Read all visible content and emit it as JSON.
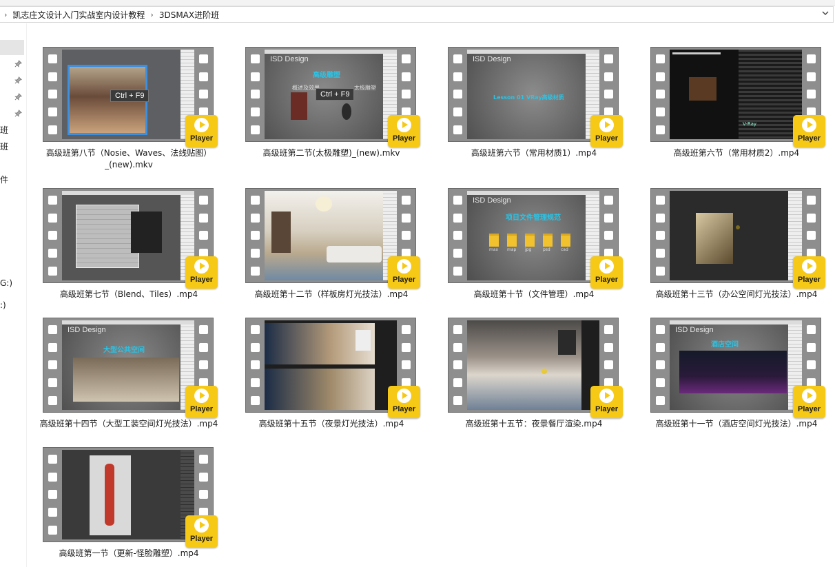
{
  "breadcrumb": {
    "items": [
      "凯志庄文设计入门实战室内设计教程",
      "3DSMAX进阶班"
    ]
  },
  "nav": {
    "fragments": [
      "班",
      "班",
      "件",
      "G:)",
      ":)"
    ]
  },
  "badge_label": "Player",
  "files": [
    {
      "name": "高级班第八节（Nosie、Waves、法线贴图）_(new).mkv",
      "style": "room-ctrl"
    },
    {
      "name": "高级班第二节(太极雕塑)_(new).mkv",
      "style": "slide-ctrl"
    },
    {
      "name": "高级班第六节（常用材质1）.mp4",
      "style": "slide-gray"
    },
    {
      "name": "高级班第六节（常用材质2）.mp4",
      "style": "material"
    },
    {
      "name": "高级班第七节（Blend、Tiles）.mp4",
      "style": "dialog"
    },
    {
      "name": "高级班第十二节（样板房灯光技法）.mp4",
      "style": "living"
    },
    {
      "name": "高级班第十节（文件管理）.mp4",
      "style": "folders"
    },
    {
      "name": "高级班第十三节（办公空间灯光技法）.mp4",
      "style": "dark-photo"
    },
    {
      "name": "高级班第十四节（大型工装空间灯光技法）.mp4",
      "style": "slide-hall"
    },
    {
      "name": "高级班第十五节（夜景灯光技法）.mp4",
      "style": "dining"
    },
    {
      "name": "高级班第十五节：夜景餐厅渲染.mp4",
      "style": "dining2"
    },
    {
      "name": "高级班第十一节（酒店空间灯光技法）.mp4",
      "style": "hotel"
    },
    {
      "name": "高级班第一节（更新-怪脸雕塑）.mp4",
      "style": "sculpt"
    }
  ],
  "screen_text": {
    "isd": "ISD Design",
    "ctrl_f9": "Ctrl + F9",
    "lesson": "Lesson 01  VRay高级材质",
    "folder_title": "项目文件管理规范",
    "hall_title": "大型公共空间",
    "hotel_title": "酒店空间",
    "slide2_title": "高级雕塑",
    "slide2_sub1": "概述及效果",
    "slide2_sub2": "太极雕塑",
    "folder_labels": [
      "max",
      "map",
      "jpg",
      "psd",
      "cad"
    ],
    "vray": "V-Ray"
  }
}
